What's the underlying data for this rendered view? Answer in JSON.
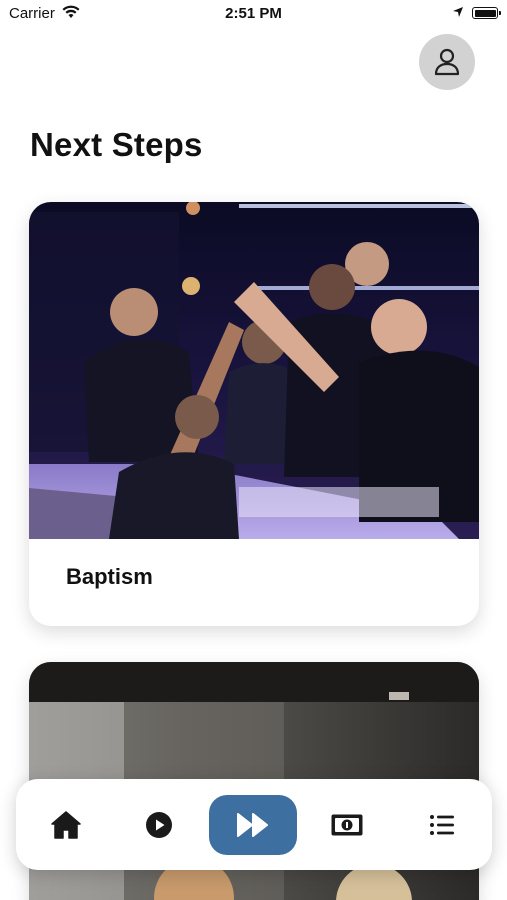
{
  "status_bar": {
    "carrier": "Carrier",
    "time": "2:51 PM",
    "wifi_icon": "wifi-icon",
    "location_icon": "location-arrow-icon",
    "battery_icon": "battery-full-icon"
  },
  "header": {
    "avatar_icon": "user-icon",
    "title": "Next Steps"
  },
  "cards": [
    {
      "label": "Baptism",
      "image": "baptism-photo"
    },
    {
      "label": "",
      "image": "people-photo"
    }
  ],
  "tab_bar": {
    "items": [
      {
        "icon": "home-icon",
        "active": false
      },
      {
        "icon": "play-circle-icon",
        "active": false
      },
      {
        "icon": "fast-forward-icon",
        "active": true
      },
      {
        "icon": "money-icon",
        "active": false
      },
      {
        "icon": "list-icon",
        "active": false
      }
    ],
    "active_color": "#3d6fa0"
  },
  "colors": {
    "background": "#ffffff",
    "avatar_bg": "#d2d2d2",
    "text": "#111111"
  }
}
